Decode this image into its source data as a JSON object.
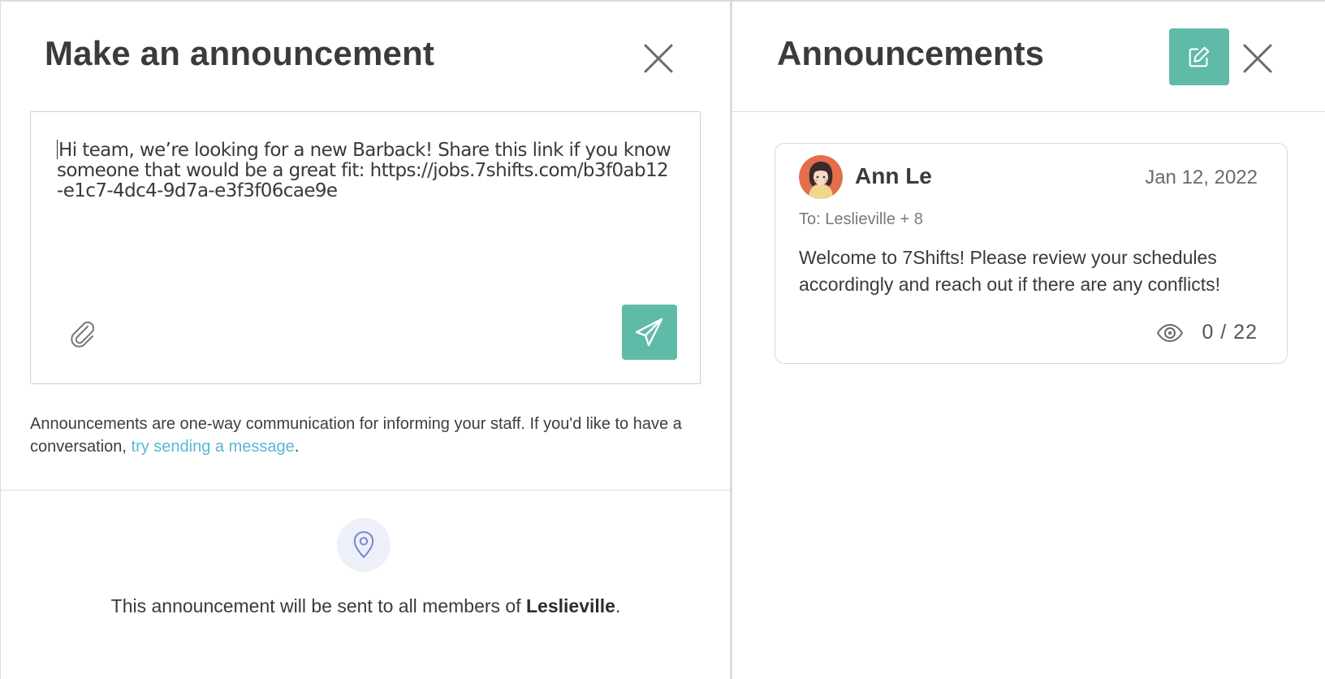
{
  "composer_panel": {
    "title": "Make an announcement",
    "message_text": "Hi team, we’re looking for a new Barback! Share this link if you know someone that would be a great fit: https://jobs.7shifts.com/b3f0ab12-e1c7-4dc4-9d7a-e3f3f06cae9e",
    "icons": {
      "close": "close-icon",
      "attach": "paperclip-icon",
      "send": "paper-plane-icon",
      "location": "map-pin-icon"
    },
    "help": {
      "text_before": "Announcements are one-way communication for informing your staff. If you'd like to have a conversation, ",
      "link_text": "try sending a message",
      "text_after": "."
    },
    "audience": {
      "text_before": "This announcement will be sent to all members of ",
      "location": "Leslieville",
      "text_after": "."
    }
  },
  "announcements_panel": {
    "title": "Announcements",
    "icons": {
      "edit": "edit-pencil-icon",
      "close": "close-icon",
      "views": "eye-icon"
    },
    "items": [
      {
        "author": "Ann Le",
        "date": "Jan 12, 2022",
        "recipients": "To: Leslieville + 8",
        "message": "Welcome to 7Shifts! Please review your schedules accordingly and reach out if there are any conflicts!",
        "views": "0 / 22"
      }
    ]
  },
  "colors": {
    "accent": "#5fbaa7",
    "link": "#59b6d6",
    "pin_bg": "#eef0f9",
    "pin_icon": "#7b86d6",
    "divider": "#dcdcdc"
  }
}
